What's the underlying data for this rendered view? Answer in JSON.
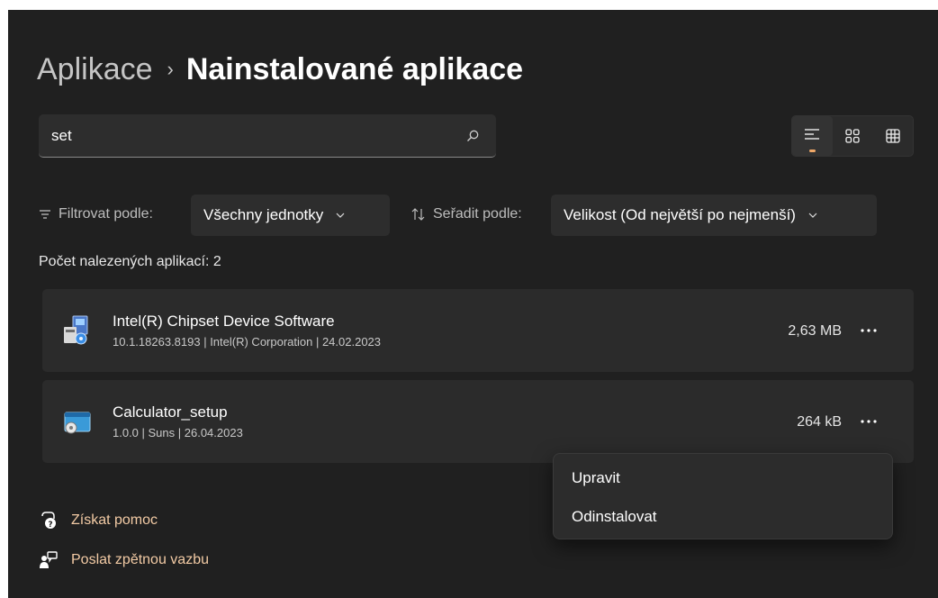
{
  "breadcrumb": {
    "parent": "Aplikace",
    "separator": "›",
    "current": "Nainstalované aplikace"
  },
  "search": {
    "value": "set",
    "icon": "search-icon"
  },
  "view_modes": [
    {
      "name": "list-view",
      "active": true
    },
    {
      "name": "grid-view",
      "active": false
    },
    {
      "name": "tile-view",
      "active": false
    }
  ],
  "filter": {
    "label": "Filtrovat podle:",
    "value": "Všechny jednotky"
  },
  "sort": {
    "label": "Seřadit podle:",
    "value": "Velikost (Od největší po nejmenší)"
  },
  "results_count": "Počet nalezených aplikací: 2",
  "apps": [
    {
      "name": "Intel(R) Chipset Device Software",
      "meta": "10.1.18263.8193  |  Intel(R) Corporation  |  24.02.2023",
      "size": "2,63 MB",
      "icon": "installer-icon"
    },
    {
      "name": "Calculator_setup",
      "meta": "1.0.0  |  Suns  |  26.04.2023",
      "size": "264 kB",
      "icon": "app-setup-icon"
    }
  ],
  "context_menu": {
    "items": [
      "Upravit",
      "Odinstalovat"
    ]
  },
  "links": [
    {
      "label": "Získat pomoc",
      "icon": "help-icon"
    },
    {
      "label": "Poslat zpětnou vazbu",
      "icon": "feedback-icon"
    }
  ],
  "colors": {
    "background": "#202020",
    "card": "#2b2b2b",
    "accent": "#f0a868",
    "link": "#f3cba5"
  }
}
